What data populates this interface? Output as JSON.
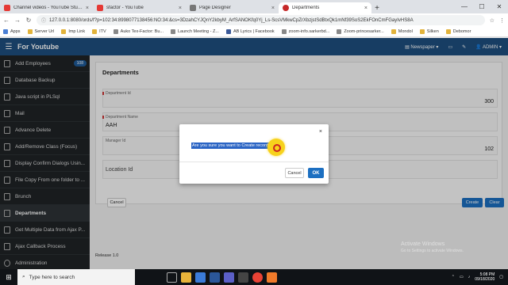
{
  "browser": {
    "tabs": [
      {
        "label": "Channel videos - YouTube Studio",
        "favicon_color": "#e53935",
        "active": false
      },
      {
        "label": "sfactor - YouTube",
        "favicon_color": "#e53935",
        "active": false
      },
      {
        "label": "Page Designer",
        "favicon_color": "#777777",
        "active": false
      },
      {
        "label": "Departments",
        "favicon_color": "#c62828",
        "active": true
      }
    ],
    "new_tab": "+",
    "url": "127.0.0.1:8080/ords/f?p=102:34:89980771384​56:NO:34:&cs=3DzahCYJQnY2kbyM_ArfSANOKfq0Yj_Ls-ScsVMkwCpZrXbzjstSdBtxQk1mNf39SoS2EkFOnCmFGayIvHS8A",
    "bookmarks": [
      "Apps",
      "Server Url",
      "Imp Link",
      "ITV",
      "Auko Tex-Factor: Bu...",
      "Launch Meeting - Z...",
      "AB Lyrics | Facebook",
      "zoom-info.sarkerbd...",
      "Zoom-princesarker...",
      "Mondol",
      "Silken",
      "Debomor"
    ]
  },
  "app": {
    "title": "For Youtube",
    "header_right": {
      "newspaper": "Newspaper",
      "user": "ADMIN"
    }
  },
  "sidebar": {
    "items": [
      {
        "label": "Add Employees",
        "badge": "108"
      },
      {
        "label": "Database Backup"
      },
      {
        "label": "Java script in PLSql"
      },
      {
        "label": "Mail"
      },
      {
        "label": "Advance Delete"
      },
      {
        "label": "Add/Remove Class (Focus)"
      },
      {
        "label": "Display Confirm Dialogs Usin..."
      },
      {
        "label": "File Copy From one folder to ..."
      },
      {
        "label": "Brunch"
      },
      {
        "label": "Departments",
        "active": true
      },
      {
        "label": "Get Multiple Data from Ajax P..."
      },
      {
        "label": "Ajax Callback Process"
      },
      {
        "label": "Administration"
      }
    ]
  },
  "form": {
    "region_title": "Departments",
    "fields": [
      {
        "label": "Department Id",
        "value": "300"
      },
      {
        "label": "Department Name",
        "value": "AAH"
      },
      {
        "label": "Manager Id",
        "value": "102"
      },
      {
        "label": "Location Id",
        "value": ""
      }
    ],
    "cancel": "Cancel",
    "create": "Create",
    "clear": "Clear"
  },
  "footer": {
    "release": "Release 1.0"
  },
  "dialog": {
    "message": "Are you sure you want to Create record?",
    "close": "×",
    "cancel": "Cancel",
    "ok": "OK"
  },
  "watermark": {
    "line1": "Activate Windows",
    "line2": "Go to Settings to activate Windows."
  },
  "taskbar": {
    "search_placeholder": "Type here to search",
    "time": "5:08 PM",
    "date": "09/18/2020"
  }
}
